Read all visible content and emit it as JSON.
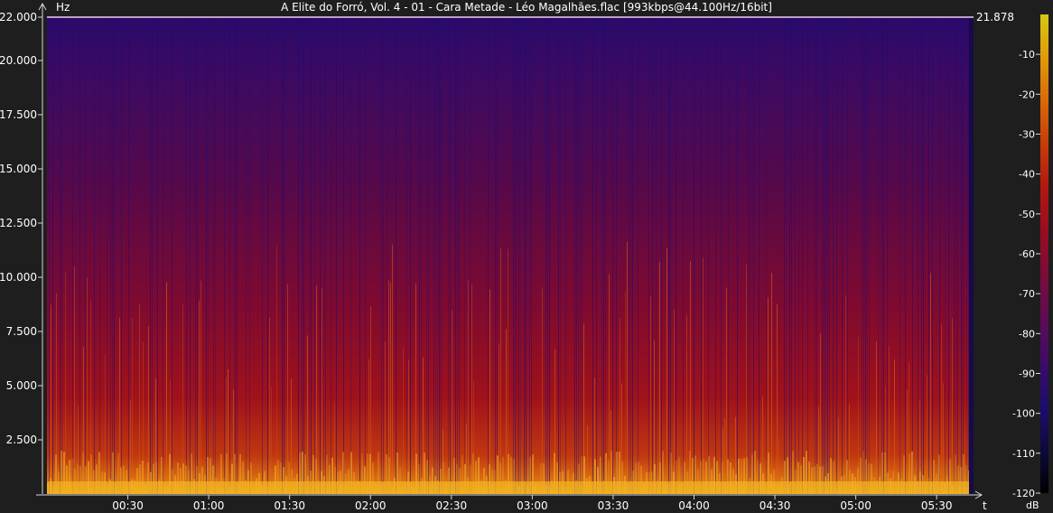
{
  "window": {
    "title": "A Elite do Forró, Vol. 4 - 01 - Cara Metade - Léo Magalhães.flac [993kbps@44.100Hz/16bit]"
  },
  "chart_data": {
    "type": "heatmap",
    "title": "A Elite do Forró, Vol. 4 - 01 - Cara Metade - Léo Magalhães.flac [993kbps@44.100Hz/16bit]",
    "ylabel": "Hz",
    "xlabel": "t",
    "colorbar_label": "dB",
    "ylim": [
      0,
      22000
    ],
    "y_ticks": [
      {
        "value": 22000,
        "label": "22.000"
      },
      {
        "value": 20000,
        "label": "20.000"
      },
      {
        "value": 17500,
        "label": "17.500"
      },
      {
        "value": 15000,
        "label": "15.000"
      },
      {
        "value": 12500,
        "label": "12.500"
      },
      {
        "value": 10000,
        "label": "10.000"
      },
      {
        "value": 7500,
        "label": "7.500"
      },
      {
        "value": 5000,
        "label": "5.000"
      },
      {
        "value": 2500,
        "label": "2.500"
      }
    ],
    "xlim_seconds": [
      0,
      342
    ],
    "x_ticks": [
      {
        "value": 30,
        "label": "00:30"
      },
      {
        "value": 60,
        "label": "01:00"
      },
      {
        "value": 90,
        "label": "01:30"
      },
      {
        "value": 120,
        "label": "02:00"
      },
      {
        "value": 150,
        "label": "02:30"
      },
      {
        "value": 180,
        "label": "03:00"
      },
      {
        "value": 210,
        "label": "03:30"
      },
      {
        "value": 240,
        "label": "04:00"
      },
      {
        "value": 270,
        "label": "04:30"
      },
      {
        "value": 300,
        "label": "05:00"
      },
      {
        "value": 330,
        "label": "05:30"
      }
    ],
    "cutoff": {
      "value": 21878,
      "label": "21.878"
    },
    "colorbar": {
      "range": [
        -120,
        0
      ],
      "ticks": [
        {
          "value": -10,
          "label": "-10"
        },
        {
          "value": -20,
          "label": "-20"
        },
        {
          "value": -30,
          "label": "-30"
        },
        {
          "value": -40,
          "label": "-40"
        },
        {
          "value": -50,
          "label": "-50"
        },
        {
          "value": -60,
          "label": "-60"
        },
        {
          "value": -70,
          "label": "-70"
        },
        {
          "value": -80,
          "label": "-80"
        },
        {
          "value": -90,
          "label": "-90"
        },
        {
          "value": -100,
          "label": "-100"
        },
        {
          "value": -110,
          "label": "-110"
        },
        {
          "value": -120,
          "label": "-120"
        }
      ],
      "colors": [
        "#000000",
        "#0d0a3c",
        "#1e0c6e",
        "#3c0c6a",
        "#5c0c55",
        "#7a0c3a",
        "#9a0c20",
        "#b31810",
        "#c83c08",
        "#d86a08",
        "#e09a0a",
        "#d8c814"
      ]
    },
    "grid": false
  }
}
